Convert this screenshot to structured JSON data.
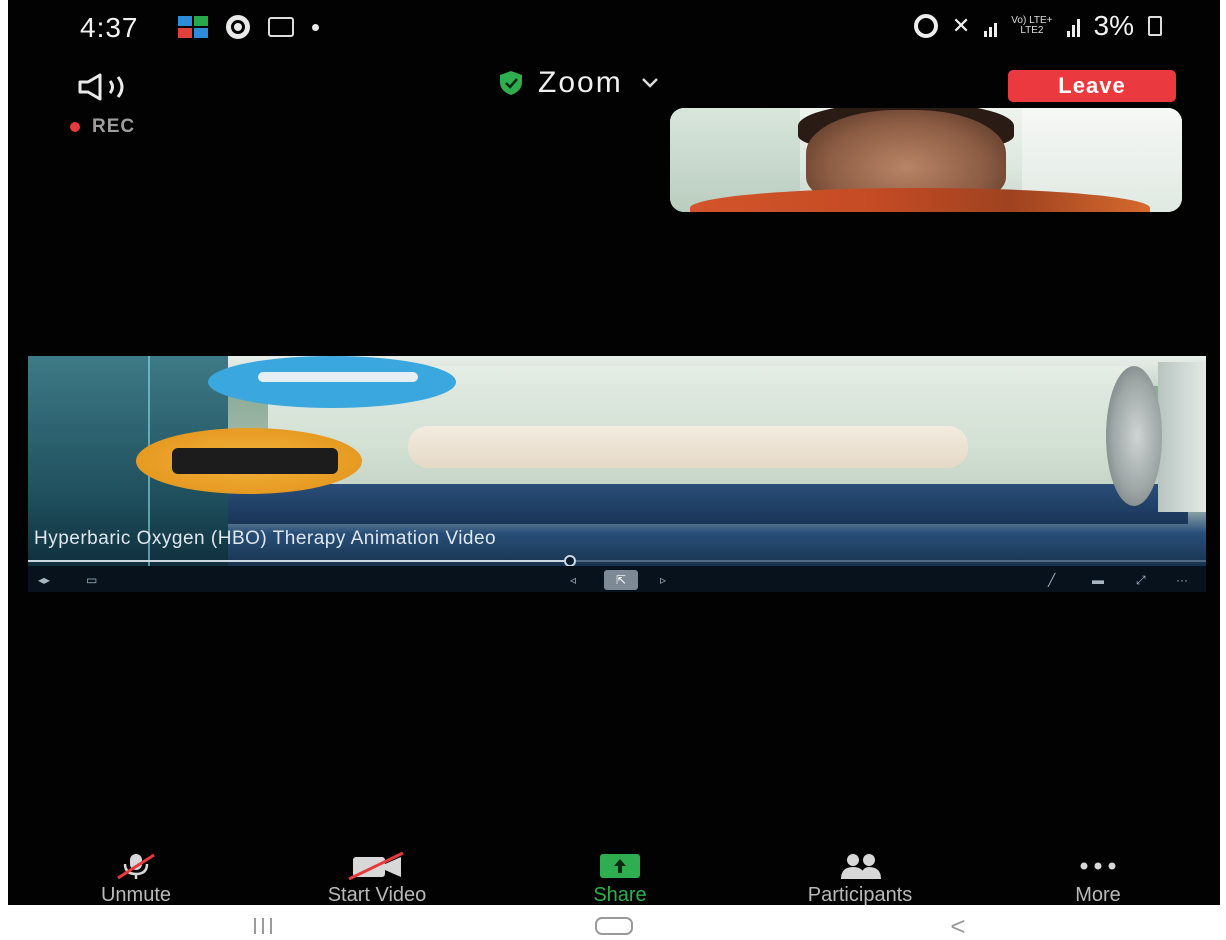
{
  "status_bar": {
    "time": "4:37",
    "battery": "3%",
    "network": {
      "top": "Vo) LTE+",
      "bottom": "LTE2"
    },
    "colors": {
      "text": "#f2f2f2",
      "background": "#020202"
    }
  },
  "meeting": {
    "recording_label": "REC",
    "title": "Zoom",
    "leave_label": "Leave",
    "colors": {
      "leave": "#ea3a3f",
      "shield": "#2fae4f",
      "rec": "#e8393e"
    }
  },
  "shared_screen": {
    "subtitle": "Hyperbaric Oxygen (HBO) Therapy Animation Video",
    "progress": 0.46
  },
  "toolbar": {
    "items": [
      {
        "label": "Unmute",
        "icon": "microphone-muted-icon"
      },
      {
        "label": "Start Video",
        "icon": "video-camera-off-icon"
      },
      {
        "label": "Share",
        "icon": "share-screen-icon"
      },
      {
        "label": "Participants",
        "icon": "participants-icon"
      },
      {
        "label": "More",
        "icon": "more-dots-icon"
      }
    ],
    "colors": {
      "label": "#b9b9b9",
      "share": "#2fae4f"
    }
  },
  "navbar": {
    "buttons": [
      "recents-icon",
      "home-icon",
      "back-icon"
    ]
  }
}
